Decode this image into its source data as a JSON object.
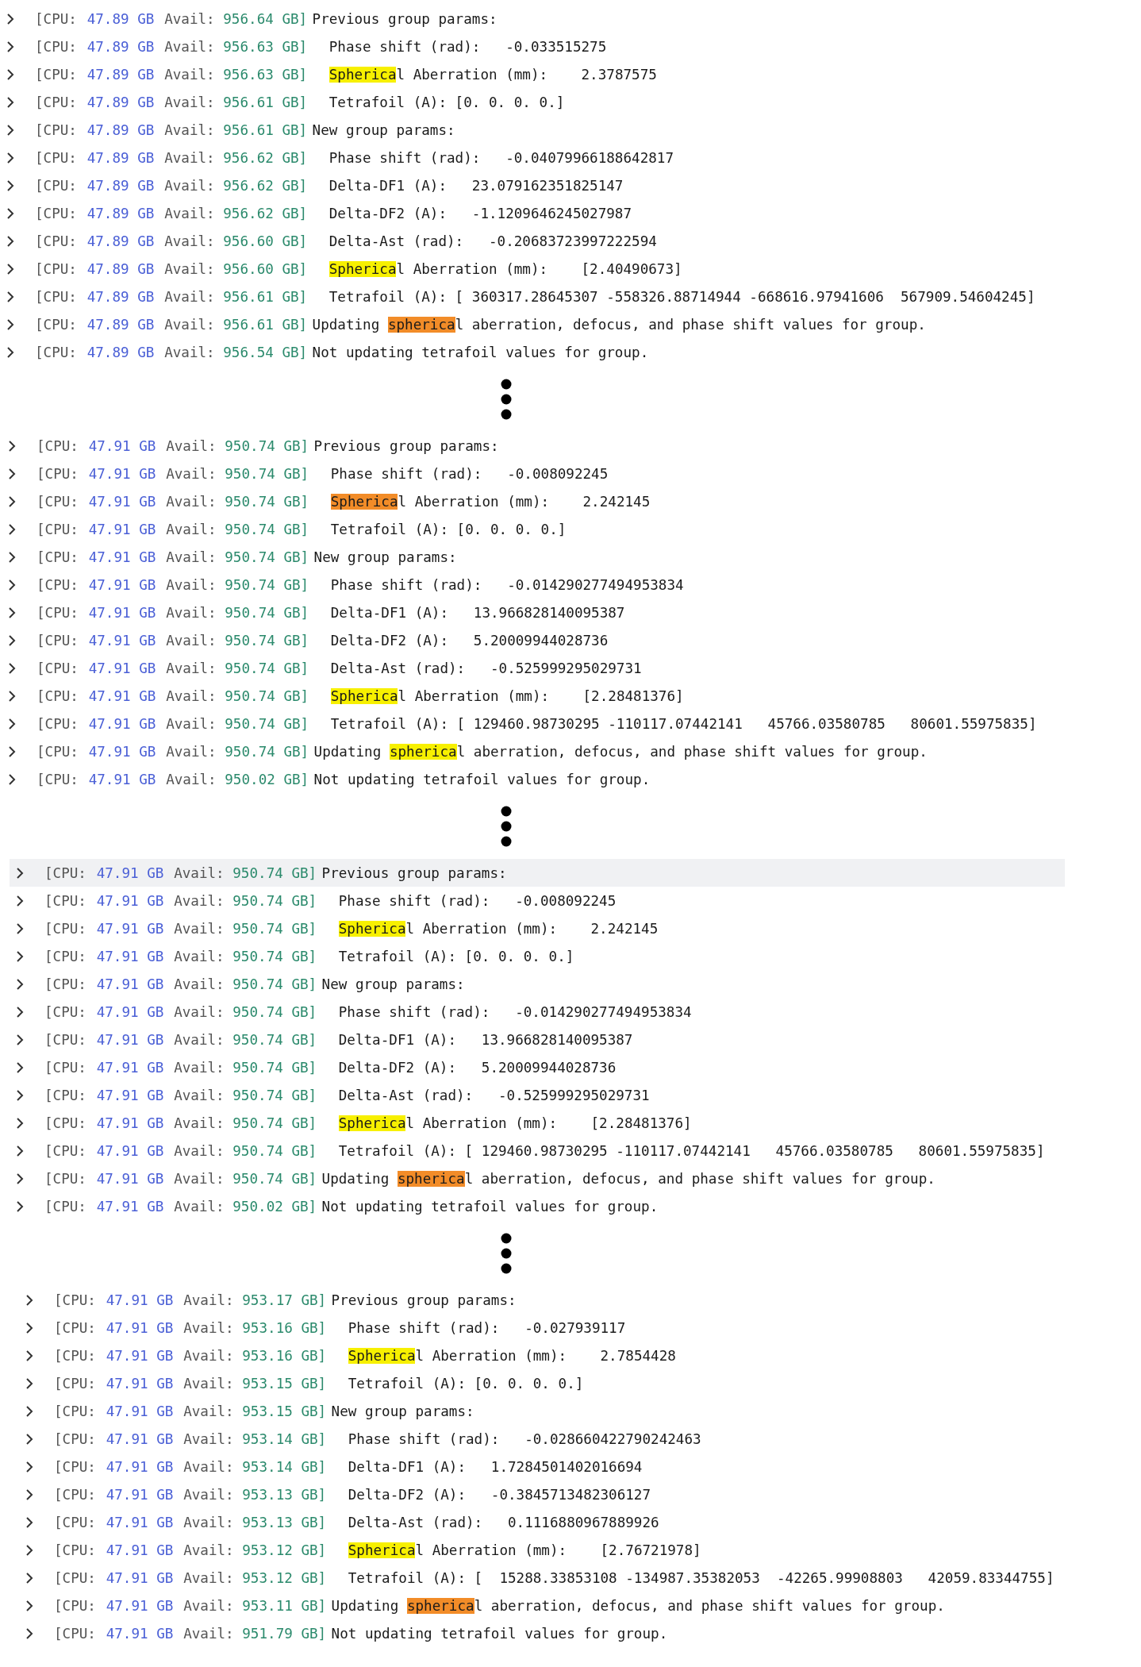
{
  "blocks": [
    {
      "rows": [
        {
          "cpu_label": "[CPU:",
          "cpu": "47.89 GB",
          "avail_label": "Avail:",
          "avail": "956.64 GB]",
          "indented": false,
          "highlighted": false,
          "text": "Previous group params:"
        },
        {
          "cpu_label": "[CPU:",
          "cpu": "47.89 GB",
          "avail_label": "Avail:",
          "avail": "956.63 GB]",
          "indented": true,
          "highlighted": false,
          "text": "Phase shift (rad):   -0.033515275"
        },
        {
          "cpu_label": "[CPU:",
          "cpu": "47.89 GB",
          "avail_label": "Avail:",
          "avail": "956.63 GB]",
          "indented": true,
          "highlighted": false,
          "before": "",
          "match": "Spherica",
          "after": "l Aberration (mm):    2.3787575",
          "current": false
        },
        {
          "cpu_label": "[CPU:",
          "cpu": "47.89 GB",
          "avail_label": "Avail:",
          "avail": "956.61 GB]",
          "indented": true,
          "highlighted": false,
          "text": "Tetrafoil (A): [0. 0. 0. 0.]"
        },
        {
          "cpu_label": "[CPU:",
          "cpu": "47.89 GB",
          "avail_label": "Avail:",
          "avail": "956.61 GB]",
          "indented": false,
          "highlighted": false,
          "text": "New group params:"
        },
        {
          "cpu_label": "[CPU:",
          "cpu": "47.89 GB",
          "avail_label": "Avail:",
          "avail": "956.62 GB]",
          "indented": true,
          "highlighted": false,
          "text": "Phase shift (rad):   -0.04079966188642817"
        },
        {
          "cpu_label": "[CPU:",
          "cpu": "47.89 GB",
          "avail_label": "Avail:",
          "avail": "956.62 GB]",
          "indented": true,
          "highlighted": false,
          "text": "Delta-DF1 (A):   23.079162351825147"
        },
        {
          "cpu_label": "[CPU:",
          "cpu": "47.89 GB",
          "avail_label": "Avail:",
          "avail": "956.62 GB]",
          "indented": true,
          "highlighted": false,
          "text": "Delta-DF2 (A):   -1.1209646245027987"
        },
        {
          "cpu_label": "[CPU:",
          "cpu": "47.89 GB",
          "avail_label": "Avail:",
          "avail": "956.60 GB]",
          "indented": true,
          "highlighted": false,
          "text": "Delta-Ast (rad):   -0.20683723997222594"
        },
        {
          "cpu_label": "[CPU:",
          "cpu": "47.89 GB",
          "avail_label": "Avail:",
          "avail": "956.60 GB]",
          "indented": true,
          "highlighted": false,
          "before": "",
          "match": "Spherica",
          "after": "l Aberration (mm):    [2.40490673]",
          "current": false
        },
        {
          "cpu_label": "[CPU:",
          "cpu": "47.89 GB",
          "avail_label": "Avail:",
          "avail": "956.61 GB]",
          "indented": true,
          "highlighted": false,
          "text": "Tetrafoil (A): [ 360317.28645307 -558326.88714944 -668616.97941606  567909.54604245]"
        },
        {
          "cpu_label": "[CPU:",
          "cpu": "47.89 GB",
          "avail_label": "Avail:",
          "avail": "956.61 GB]",
          "indented": false,
          "highlighted": false,
          "before": "Updating ",
          "match": "spherica",
          "after": "l aberration, defocus, and phase shift values for group.",
          "current": true
        },
        {
          "cpu_label": "[CPU:",
          "cpu": "47.89 GB",
          "avail_label": "Avail:",
          "avail": "956.54 GB]",
          "indented": false,
          "highlighted": false,
          "text": "Not updating tetrafoil values for group."
        }
      ]
    },
    {
      "rows": [
        {
          "cpu_label": "[CPU:",
          "cpu": "47.91 GB",
          "avail_label": "Avail:",
          "avail": "950.74 GB]",
          "indented": false,
          "highlighted": false,
          "text": "Previous group params:"
        },
        {
          "cpu_label": "[CPU:",
          "cpu": "47.91 GB",
          "avail_label": "Avail:",
          "avail": "950.74 GB]",
          "indented": true,
          "highlighted": false,
          "text": "Phase shift (rad):   -0.008092245"
        },
        {
          "cpu_label": "[CPU:",
          "cpu": "47.91 GB",
          "avail_label": "Avail:",
          "avail": "950.74 GB]",
          "indented": true,
          "highlighted": false,
          "before": "",
          "match": "Spherica",
          "after": "l Aberration (mm):    2.242145",
          "current": true
        },
        {
          "cpu_label": "[CPU:",
          "cpu": "47.91 GB",
          "avail_label": "Avail:",
          "avail": "950.74 GB]",
          "indented": true,
          "highlighted": false,
          "text": "Tetrafoil (A): [0. 0. 0. 0.]"
        },
        {
          "cpu_label": "[CPU:",
          "cpu": "47.91 GB",
          "avail_label": "Avail:",
          "avail": "950.74 GB]",
          "indented": false,
          "highlighted": false,
          "text": "New group params:"
        },
        {
          "cpu_label": "[CPU:",
          "cpu": "47.91 GB",
          "avail_label": "Avail:",
          "avail": "950.74 GB]",
          "indented": true,
          "highlighted": false,
          "text": "Phase shift (rad):   -0.014290277494953834"
        },
        {
          "cpu_label": "[CPU:",
          "cpu": "47.91 GB",
          "avail_label": "Avail:",
          "avail": "950.74 GB]",
          "indented": true,
          "highlighted": false,
          "text": "Delta-DF1 (A):   13.966828140095387"
        },
        {
          "cpu_label": "[CPU:",
          "cpu": "47.91 GB",
          "avail_label": "Avail:",
          "avail": "950.74 GB]",
          "indented": true,
          "highlighted": false,
          "text": "Delta-DF2 (A):   5.20009944028736"
        },
        {
          "cpu_label": "[CPU:",
          "cpu": "47.91 GB",
          "avail_label": "Avail:",
          "avail": "950.74 GB]",
          "indented": true,
          "highlighted": false,
          "text": "Delta-Ast (rad):   -0.525999295029731"
        },
        {
          "cpu_label": "[CPU:",
          "cpu": "47.91 GB",
          "avail_label": "Avail:",
          "avail": "950.74 GB]",
          "indented": true,
          "highlighted": false,
          "before": "",
          "match": "Spherica",
          "after": "l Aberration (mm):    [2.28481376]",
          "current": false
        },
        {
          "cpu_label": "[CPU:",
          "cpu": "47.91 GB",
          "avail_label": "Avail:",
          "avail": "950.74 GB]",
          "indented": true,
          "highlighted": false,
          "text": "Tetrafoil (A): [ 129460.98730295 -110117.07442141   45766.03580785   80601.55975835]"
        },
        {
          "cpu_label": "[CPU:",
          "cpu": "47.91 GB",
          "avail_label": "Avail:",
          "avail": "950.74 GB]",
          "indented": false,
          "highlighted": false,
          "before": "Updating ",
          "match": "spherica",
          "after": "l aberration, defocus, and phase shift values for group.",
          "current": false
        },
        {
          "cpu_label": "[CPU:",
          "cpu": "47.91 GB",
          "avail_label": "Avail:",
          "avail": "950.02 GB]",
          "indented": false,
          "highlighted": false,
          "text": "Not updating tetrafoil values for group."
        }
      ]
    },
    {
      "rows": [
        {
          "cpu_label": "[CPU:",
          "cpu": "47.91 GB",
          "avail_label": "Avail:",
          "avail": "950.74 GB]",
          "indented": false,
          "highlighted": true,
          "text": "Previous group params:"
        },
        {
          "cpu_label": "[CPU:",
          "cpu": "47.91 GB",
          "avail_label": "Avail:",
          "avail": "950.74 GB]",
          "indented": true,
          "highlighted": false,
          "text": "Phase shift (rad):   -0.008092245"
        },
        {
          "cpu_label": "[CPU:",
          "cpu": "47.91 GB",
          "avail_label": "Avail:",
          "avail": "950.74 GB]",
          "indented": true,
          "highlighted": false,
          "before": "",
          "match": "Spherica",
          "after": "l Aberration (mm):    2.242145",
          "current": false
        },
        {
          "cpu_label": "[CPU:",
          "cpu": "47.91 GB",
          "avail_label": "Avail:",
          "avail": "950.74 GB]",
          "indented": true,
          "highlighted": false,
          "text": "Tetrafoil (A): [0. 0. 0. 0.]"
        },
        {
          "cpu_label": "[CPU:",
          "cpu": "47.91 GB",
          "avail_label": "Avail:",
          "avail": "950.74 GB]",
          "indented": false,
          "highlighted": false,
          "text": "New group params:"
        },
        {
          "cpu_label": "[CPU:",
          "cpu": "47.91 GB",
          "avail_label": "Avail:",
          "avail": "950.74 GB]",
          "indented": true,
          "highlighted": false,
          "text": "Phase shift (rad):   -0.014290277494953834"
        },
        {
          "cpu_label": "[CPU:",
          "cpu": "47.91 GB",
          "avail_label": "Avail:",
          "avail": "950.74 GB]",
          "indented": true,
          "highlighted": false,
          "text": "Delta-DF1 (A):   13.966828140095387"
        },
        {
          "cpu_label": "[CPU:",
          "cpu": "47.91 GB",
          "avail_label": "Avail:",
          "avail": "950.74 GB]",
          "indented": true,
          "highlighted": false,
          "text": "Delta-DF2 (A):   5.20009944028736"
        },
        {
          "cpu_label": "[CPU:",
          "cpu": "47.91 GB",
          "avail_label": "Avail:",
          "avail": "950.74 GB]",
          "indented": true,
          "highlighted": false,
          "text": "Delta-Ast (rad):   -0.525999295029731"
        },
        {
          "cpu_label": "[CPU:",
          "cpu": "47.91 GB",
          "avail_label": "Avail:",
          "avail": "950.74 GB]",
          "indented": true,
          "highlighted": false,
          "before": "",
          "match": "Spherica",
          "after": "l Aberration (mm):    [2.28481376]",
          "current": false
        },
        {
          "cpu_label": "[CPU:",
          "cpu": "47.91 GB",
          "avail_label": "Avail:",
          "avail": "950.74 GB]",
          "indented": true,
          "highlighted": false,
          "text": "Tetrafoil (A): [ 129460.98730295 -110117.07442141   45766.03580785   80601.55975835]"
        },
        {
          "cpu_label": "[CPU:",
          "cpu": "47.91 GB",
          "avail_label": "Avail:",
          "avail": "950.74 GB]",
          "indented": false,
          "highlighted": false,
          "before": "Updating ",
          "match": "spherica",
          "after": "l aberration, defocus, and phase shift values for group.",
          "current": true
        },
        {
          "cpu_label": "[CPU:",
          "cpu": "47.91 GB",
          "avail_label": "Avail:",
          "avail": "950.02 GB]",
          "indented": false,
          "highlighted": false,
          "text": "Not updating tetrafoil values for group."
        }
      ]
    },
    {
      "rows": [
        {
          "cpu_label": "[CPU:",
          "cpu": "47.91 GB",
          "avail_label": "Avail:",
          "avail": "953.17 GB]",
          "indented": false,
          "highlighted": false,
          "text": "Previous group params:"
        },
        {
          "cpu_label": "[CPU:",
          "cpu": "47.91 GB",
          "avail_label": "Avail:",
          "avail": "953.16 GB]",
          "indented": true,
          "highlighted": false,
          "text": "Phase shift (rad):   -0.027939117"
        },
        {
          "cpu_label": "[CPU:",
          "cpu": "47.91 GB",
          "avail_label": "Avail:",
          "avail": "953.16 GB]",
          "indented": true,
          "highlighted": false,
          "before": "",
          "match": "Spherica",
          "after": "l Aberration (mm):    2.7854428",
          "current": false
        },
        {
          "cpu_label": "[CPU:",
          "cpu": "47.91 GB",
          "avail_label": "Avail:",
          "avail": "953.15 GB]",
          "indented": true,
          "highlighted": false,
          "text": "Tetrafoil (A): [0. 0. 0. 0.]"
        },
        {
          "cpu_label": "[CPU:",
          "cpu": "47.91 GB",
          "avail_label": "Avail:",
          "avail": "953.15 GB]",
          "indented": false,
          "highlighted": false,
          "text": "New group params:"
        },
        {
          "cpu_label": "[CPU:",
          "cpu": "47.91 GB",
          "avail_label": "Avail:",
          "avail": "953.14 GB]",
          "indented": true,
          "highlighted": false,
          "text": "Phase shift (rad):   -0.028660422790242463"
        },
        {
          "cpu_label": "[CPU:",
          "cpu": "47.91 GB",
          "avail_label": "Avail:",
          "avail": "953.14 GB]",
          "indented": true,
          "highlighted": false,
          "text": "Delta-DF1 (A):   1.7284501402016694"
        },
        {
          "cpu_label": "[CPU:",
          "cpu": "47.91 GB",
          "avail_label": "Avail:",
          "avail": "953.13 GB]",
          "indented": true,
          "highlighted": false,
          "text": "Delta-DF2 (A):   -0.3845713482306127"
        },
        {
          "cpu_label": "[CPU:",
          "cpu": "47.91 GB",
          "avail_label": "Avail:",
          "avail": "953.13 GB]",
          "indented": true,
          "highlighted": false,
          "text": "Delta-Ast (rad):   0.1116880967889926"
        },
        {
          "cpu_label": "[CPU:",
          "cpu": "47.91 GB",
          "avail_label": "Avail:",
          "avail": "953.12 GB]",
          "indented": true,
          "highlighted": false,
          "before": "",
          "match": "Spherica",
          "after": "l Aberration (mm):    [2.76721978]",
          "current": false
        },
        {
          "cpu_label": "[CPU:",
          "cpu": "47.91 GB",
          "avail_label": "Avail:",
          "avail": "953.12 GB]",
          "indented": true,
          "highlighted": false,
          "text": "Tetrafoil (A): [  15288.33853108 -134987.35382053  -42265.99908803   42059.83344755]"
        },
        {
          "cpu_label": "[CPU:",
          "cpu": "47.91 GB",
          "avail_label": "Avail:",
          "avail": "953.11 GB]",
          "indented": false,
          "highlighted": false,
          "before": "Updating ",
          "match": "spherica",
          "after": "l aberration, defocus, and phase shift values for group.",
          "current": true
        },
        {
          "cpu_label": "[CPU:",
          "cpu": "47.91 GB",
          "avail_label": "Avail:",
          "avail": "951.79 GB]",
          "indented": false,
          "highlighted": false,
          "text": "Not updating tetrafoil values for group."
        }
      ]
    }
  ]
}
